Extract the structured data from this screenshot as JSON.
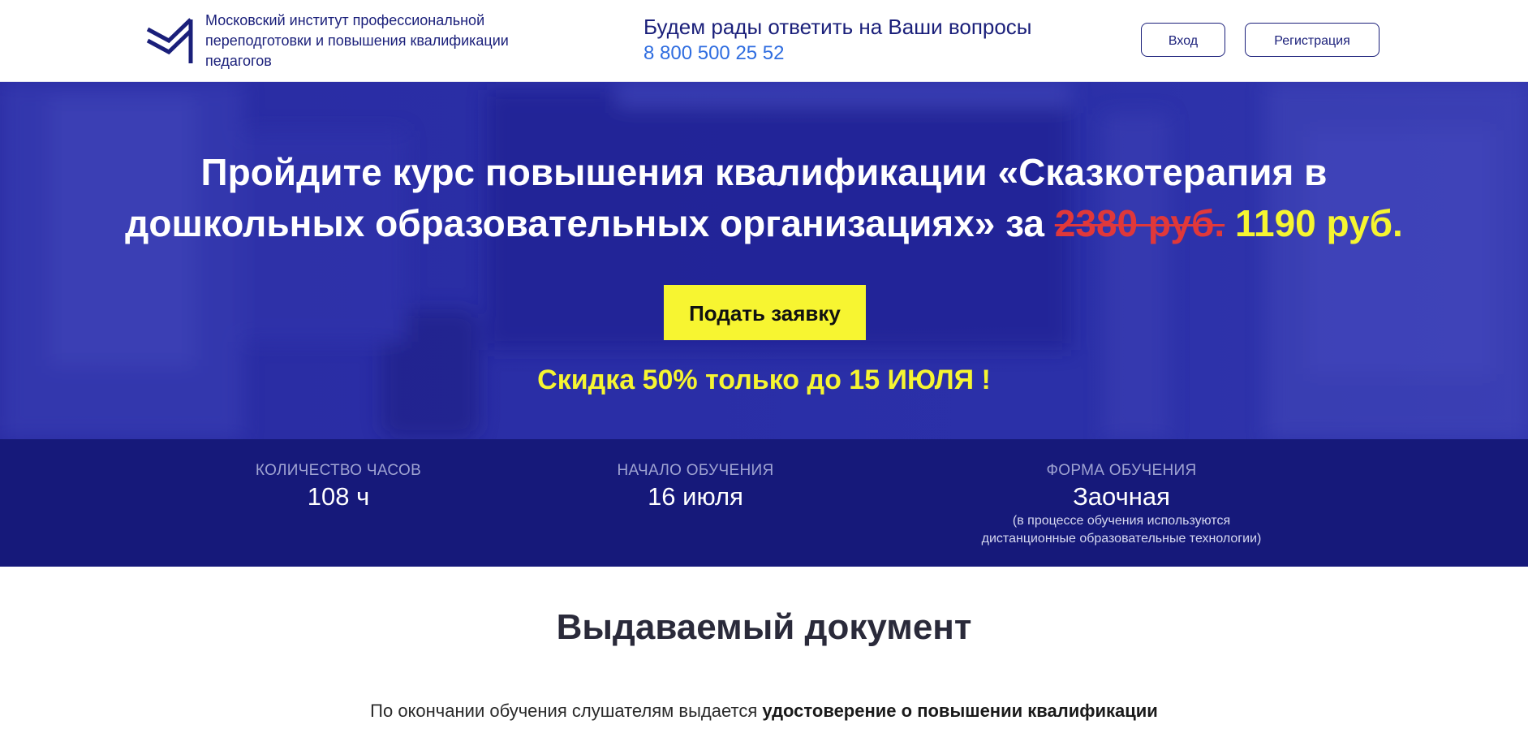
{
  "header": {
    "org_name": "Московский институт профессиональной переподготовки и повышения квалификации педагогов",
    "contact_text": "Будем рады ответить на Ваши вопросы",
    "phone": "8 800 500 25 52",
    "login_label": "Вход",
    "register_label": "Регистрация"
  },
  "hero": {
    "title_main": "Пройдите курс повышения квалификации «Сказкотерапия в дошкольных образовательных организациях» за",
    "old_price": "2380 руб.",
    "new_price": "1190 руб.",
    "apply_label": "Подать заявку",
    "discount": "Скидка 50% только до 15 ИЮЛЯ !"
  },
  "info": {
    "hours_label": "КОЛИЧЕСТВО ЧАСОВ",
    "hours_value": "108 ч",
    "start_label": "НАЧАЛО ОБУЧЕНИЯ",
    "start_value": "16 июля",
    "form_label": "ФОРМА ОБУЧЕНИЯ",
    "form_value": "Заочная",
    "form_note_1": "(в процессе обучения используются",
    "form_note_2": "дистанционные образовательные технологии)"
  },
  "document": {
    "title": "Выдаваемый документ",
    "text_prefix": "По окончании обучения слушателям выдается",
    "text_bold": "удостоверение о повышении квалификации"
  },
  "colors": {
    "brand_navy": "#1a1f7a",
    "hero_blue": "#2a2ea6",
    "strip_navy": "#16197a",
    "accent_yellow": "#f6f531",
    "old_price_red": "#e0383a",
    "phone_blue": "#2f6de0"
  }
}
